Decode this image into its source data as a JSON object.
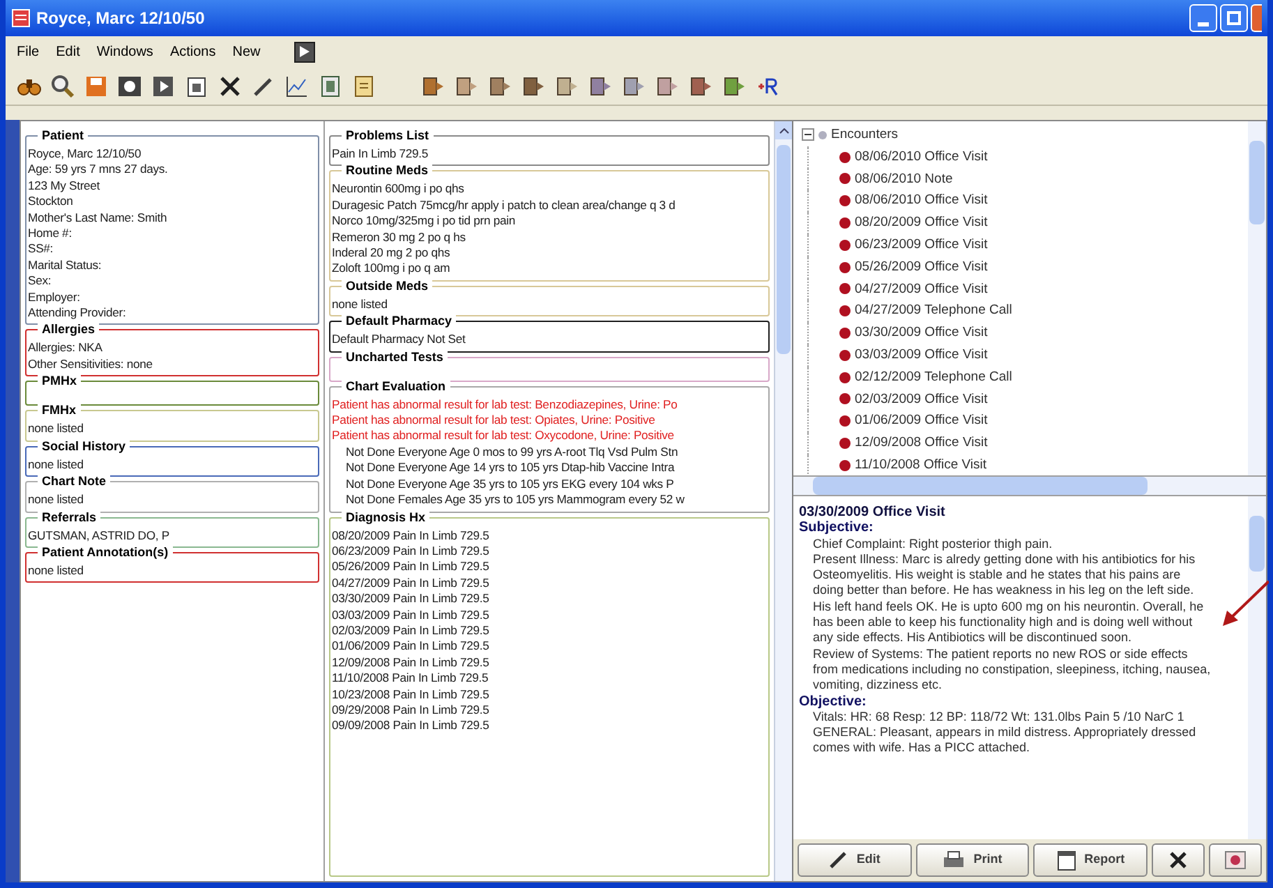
{
  "window": {
    "title": "Royce, Marc  12/10/50"
  },
  "menu": [
    "File",
    "Edit",
    "Windows",
    "Actions",
    "New"
  ],
  "left_sections": [
    {
      "title": "Patient",
      "color": "#7f8fa8",
      "lines": [
        "Royce, Marc  12/10/50",
        "Age: 59 yrs 7 mns 27 days.",
        "123 My Street",
        "Stockton",
        "Mother's Last Name: Smith",
        "Home #:",
        "SS#:",
        "Marital Status:",
        "Sex:",
        "Employer:",
        "Attending Provider:"
      ]
    },
    {
      "title": "Allergies",
      "color": "#d03030",
      "lines": [
        "Allergies: NKA",
        "Other Sensitivities: none"
      ]
    },
    {
      "title": "PMHx",
      "color": "#6a8a3a"
    },
    {
      "title": "FMHx",
      "color": "#c8c890",
      "lines": [
        "none listed"
      ]
    },
    {
      "title": "Social History",
      "color": "#4a6ab8",
      "lines": [
        "none listed"
      ]
    },
    {
      "title": "Chart Note",
      "color": "#b0b0b0",
      "lines": [
        "none listed"
      ]
    },
    {
      "title": "Referrals",
      "color": "#8ab890",
      "lines": [
        "GUTSMAN, ASTRID   DO, P"
      ]
    },
    {
      "title": "Patient Annotation(s)",
      "color": "#d03030",
      "lines": [
        "none listed"
      ]
    }
  ],
  "middle_sections": [
    {
      "title": "Problems List",
      "color": "#8a8a8a",
      "lines": [
        {
          "kind": "item",
          "text": "Pain In Limb  729.5"
        }
      ]
    },
    {
      "title": "Routine Meds",
      "color": "#d8c898",
      "lines": [
        {
          "kind": "item",
          "text": "Neurontin 600mg i po qhs"
        },
        {
          "kind": "item",
          "text": "Duragesic Patch 75mcg/hr apply i patch to clean area/change q 3 d"
        },
        {
          "kind": "item",
          "text": "Norco 10mg/325mg i po tid prn pain"
        },
        {
          "kind": "item",
          "text": "Remeron 30 mg 2 po q hs"
        },
        {
          "kind": "item",
          "text": "Inderal 20 mg 2 po qhs"
        },
        {
          "kind": "item",
          "text": "Zoloft 100mg i po q am"
        }
      ]
    },
    {
      "title": "Outside Meds",
      "color": "#d8c898",
      "lines": [
        {
          "kind": "item",
          "text": "none listed"
        }
      ]
    },
    {
      "title": "Default Pharmacy",
      "color": "#202020",
      "lines": [
        {
          "kind": "item",
          "text": "Default Pharmacy Not Set"
        }
      ]
    },
    {
      "title": "Uncharted Tests",
      "color": "#d8a8c8"
    },
    {
      "title": "Chart Evaluation",
      "color": "#a8a8a8",
      "lines": [
        {
          "kind": "alert",
          "text": "Patient has abnormal result for lab test: Benzodiazepines, Urine: Po"
        },
        {
          "kind": "alert",
          "text": "Patient has abnormal result for lab test: Opiates, Urine: Positive"
        },
        {
          "kind": "alert",
          "text": "Patient has abnormal result for lab test: Oxycodone, Urine: Positive"
        },
        {
          "kind": "reminder",
          "text": "Not Done Everyone Age 0 mos  to 99 yrs A-root Tlq Vsd Pulm Stn"
        },
        {
          "kind": "reminder",
          "text": "Not Done Everyone Age 14 yrs  to 105 yrs Dtap-hib Vaccine Intra"
        },
        {
          "kind": "reminder",
          "text": "Not Done Everyone Age 35 yrs  to 105 yrs EKG every 104 wks  P"
        },
        {
          "kind": "reminder",
          "text": "Not Done Females Age 35 yrs  to 105 yrs Mammogram every 52 w"
        }
      ]
    },
    {
      "title": "Diagnosis Hx",
      "color": "#b8c888",
      "lines": [
        {
          "kind": "item",
          "text": "08/20/2009  Pain In Limb  729.5"
        },
        {
          "kind": "item",
          "text": "06/23/2009  Pain In Limb  729.5"
        },
        {
          "kind": "item",
          "text": "05/26/2009  Pain In Limb  729.5"
        },
        {
          "kind": "item",
          "text": "04/27/2009  Pain In Limb  729.5"
        },
        {
          "kind": "item",
          "text": "03/30/2009  Pain In Limb  729.5"
        },
        {
          "kind": "item",
          "text": "03/03/2009  Pain In Limb  729.5"
        },
        {
          "kind": "item",
          "text": "02/03/2009  Pain In Limb  729.5"
        },
        {
          "kind": "item",
          "text": "01/06/2009  Pain In Limb  729.5"
        },
        {
          "kind": "item",
          "text": "12/09/2008  Pain In Limb  729.5"
        },
        {
          "kind": "item",
          "text": "11/10/2008  Pain In Limb  729.5"
        },
        {
          "kind": "item",
          "text": "10/23/2008  Pain In Limb  729.5"
        },
        {
          "kind": "item",
          "text": "09/29/2008  Pain In Limb  729.5"
        },
        {
          "kind": "item",
          "text": "09/09/2008  Pain In Limb  729.5"
        }
      ]
    }
  ],
  "encounters": {
    "label": "Encounters",
    "expanded": true,
    "items": [
      {
        "date": "08/06/2010",
        "type": "Office Visit"
      },
      {
        "date": "08/06/2010",
        "type": "Note"
      },
      {
        "date": "08/06/2010",
        "type": "Office Visit"
      },
      {
        "date": "08/20/2009",
        "type": "Office Visit"
      },
      {
        "date": "06/23/2009",
        "type": "Office Visit"
      },
      {
        "date": "05/26/2009",
        "type": "Office Visit"
      },
      {
        "date": "04/27/2009",
        "type": "Office Visit"
      },
      {
        "date": "04/27/2009",
        "type": "Telephone Call"
      },
      {
        "date": "03/30/2009",
        "type": "Office Visit"
      },
      {
        "date": "03/03/2009",
        "type": "Office Visit"
      },
      {
        "date": "02/12/2009",
        "type": "Telephone Call"
      },
      {
        "date": "02/03/2009",
        "type": "Office Visit"
      },
      {
        "date": "01/06/2009",
        "type": "Office Visit"
      },
      {
        "date": "12/09/2008",
        "type": "Office Visit"
      },
      {
        "date": "11/10/2008",
        "type": "Office Visit"
      }
    ]
  },
  "note": {
    "title": "03/30/2009  Office Visit",
    "blocks": [
      {
        "kind": "heading",
        "text": "Subjective:"
      },
      {
        "kind": "para",
        "text": "Chief Complaint: Right posterior thigh pain."
      },
      {
        "kind": "para",
        "text": "Present Illness: Marc is alredy getting done with his antibiotics for his Osteomyelitis. His weight is stable and he states that his pains are doing better than before. He has weakness in his leg on the left side. His left hand feels OK. He is upto 600 mg on his neurontin. Overall, he has been able to keep his functionality high and is doing well without any side effects. His Antibiotics will be discontinued soon."
      },
      {
        "kind": "para",
        "text": "Review of Systems: The patient reports no new ROS or side effects from medications including no constipation, sleepiness, itching, nausea, vomiting, dizziness etc."
      },
      {
        "kind": "heading",
        "text": "Objective:"
      },
      {
        "kind": "para",
        "text": "Vitals: HR: 68  Resp: 12  BP: 118/72  Wt: 131.0lbs  Pain 5 /10  NarC 1"
      },
      {
        "kind": "para",
        "text": "GENERAL: Pleasant, appears in mild distress. Appropriately dressed comes with wife. Has a PICC attached."
      }
    ]
  },
  "note_buttons": [
    {
      "kind": "edit",
      "label": "Edit"
    },
    {
      "kind": "print",
      "label": "Print"
    },
    {
      "kind": "report",
      "label": "Report"
    },
    {
      "kind": "delete"
    },
    {
      "kind": "sign"
    }
  ]
}
